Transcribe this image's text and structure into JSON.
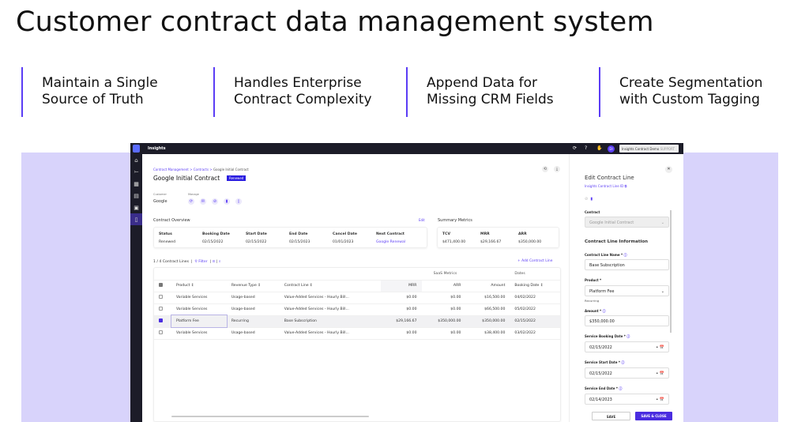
{
  "headline": "Customer contract data management system",
  "pillars": [
    "Maintain a Single Source of Truth",
    "Handles Enterprise Contract Complexity",
    "Append Data for Missing CRM Fields",
    "Create Segmentation with Custom Tagging"
  ],
  "app": {
    "name": "Insights",
    "account": "Insights Contract Demo",
    "account_badge": "SUPPORT",
    "avatar": "DI",
    "breadcrumb": [
      "Contract Management",
      "Contracts",
      "Google Initial Contract"
    ],
    "contract_title": "Google Initial Contract",
    "status_badge": "Renewed",
    "customer_label": "Customer",
    "customer": "Google",
    "manage_label": "Manage",
    "overview_title": "Contract Overview",
    "edit": "Edit",
    "overview": [
      {
        "k": "Status",
        "v": "Renewed"
      },
      {
        "k": "Booking Date",
        "v": "02/15/2022"
      },
      {
        "k": "Start Date",
        "v": "02/15/2022"
      },
      {
        "k": "End Date",
        "v": "02/15/2023"
      },
      {
        "k": "Cancel Date",
        "v": "01/01/2023"
      },
      {
        "k": "Next Contract",
        "v": "Google Renewal"
      }
    ],
    "summary_title": "Summary Metrics",
    "summary": [
      {
        "k": "TCV",
        "v": "$471,400.00"
      },
      {
        "k": "MRR",
        "v": "$29,166.67"
      },
      {
        "k": "ARR",
        "v": "$350,000.00"
      }
    ],
    "lines_count": "1 / 4 Contract Lines",
    "filter": "Filter",
    "add_line": "+ Add Contract Line",
    "group_headers": {
      "saas": "SaaS Metrics",
      "dates": "Dates"
    },
    "columns": [
      "Product",
      "Revenue Type",
      "Contract Line",
      "MRR",
      "ARR",
      "Amount",
      "Booking Date"
    ],
    "rows": [
      {
        "checked": false,
        "cells": [
          "Variable Services",
          "Usage-based",
          "Value-Added Services - Hourly Bill...",
          "$0.00",
          "$0.00",
          "$16,500.00",
          "04/02/2022"
        ]
      },
      {
        "checked": false,
        "cells": [
          "Variable Services",
          "Usage-based",
          "Value-Added Services - Hourly Bill...",
          "$0.00",
          "$0.00",
          "$66,500.00",
          "05/02/2022"
        ]
      },
      {
        "checked": true,
        "cells": [
          "Platform Fee",
          "Recurring",
          "Base Subscription",
          "$29,166.67",
          "$350,000.00",
          "$350,000.00",
          "02/15/2022"
        ]
      },
      {
        "checked": false,
        "cells": [
          "Variable Services",
          "Usage-based",
          "Value-Added Services - Hourly Bill...",
          "$0.00",
          "$0.00",
          "$38,400.00",
          "03/02/2022"
        ]
      }
    ],
    "panel": {
      "title": "Edit Contract Line",
      "id_link": "Insights Contract Line ID",
      "contract_label": "Contract",
      "contract_value": "Google Initial Contract",
      "section": "Contract Line Information",
      "name_label": "Contract Line Name *",
      "name_value": "Base Subscription",
      "product_label": "Product *",
      "product_value": "Platform Fee",
      "product_hint": "Recurring",
      "amount_label": "Amount *",
      "amount_value": "$350,000.00",
      "booking_label": "Service Booking Date *",
      "booking_value": "02/15/2022",
      "start_label": "Service Start Date *",
      "start_value": "02/15/2022",
      "end_label": "Service End Date *",
      "end_value": "02/14/2023",
      "save": "SAVE",
      "save_close": "SAVE & CLOSE"
    }
  }
}
